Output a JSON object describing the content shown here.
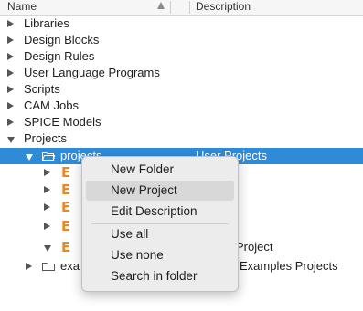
{
  "header": {
    "name_label": "Name",
    "description_label": "Description"
  },
  "tree": {
    "items": [
      {
        "label": "Libraries"
      },
      {
        "label": "Design Blocks"
      },
      {
        "label": "Design Rules"
      },
      {
        "label": "User Language Programs"
      },
      {
        "label": "Scripts"
      },
      {
        "label": "CAM Jobs"
      },
      {
        "label": "SPICE Models"
      },
      {
        "label": "Projects"
      }
    ],
    "projects_folder": {
      "label": "projects",
      "description": "User Projects"
    },
    "last_child_description": "Project",
    "examples_folder": {
      "label": "exa",
      "description": "Examples Projects"
    }
  },
  "context_menu": {
    "items": [
      {
        "label": "New Folder"
      },
      {
        "label": "New Project"
      },
      {
        "label": "Edit Description"
      },
      {
        "label": "Use all"
      },
      {
        "label": "Use none"
      },
      {
        "label": "Search in folder"
      }
    ]
  },
  "colors": {
    "selection": "#2f8bd8",
    "eagle_icon": "#e7882a",
    "menu_hover": "#d8d8d8"
  }
}
